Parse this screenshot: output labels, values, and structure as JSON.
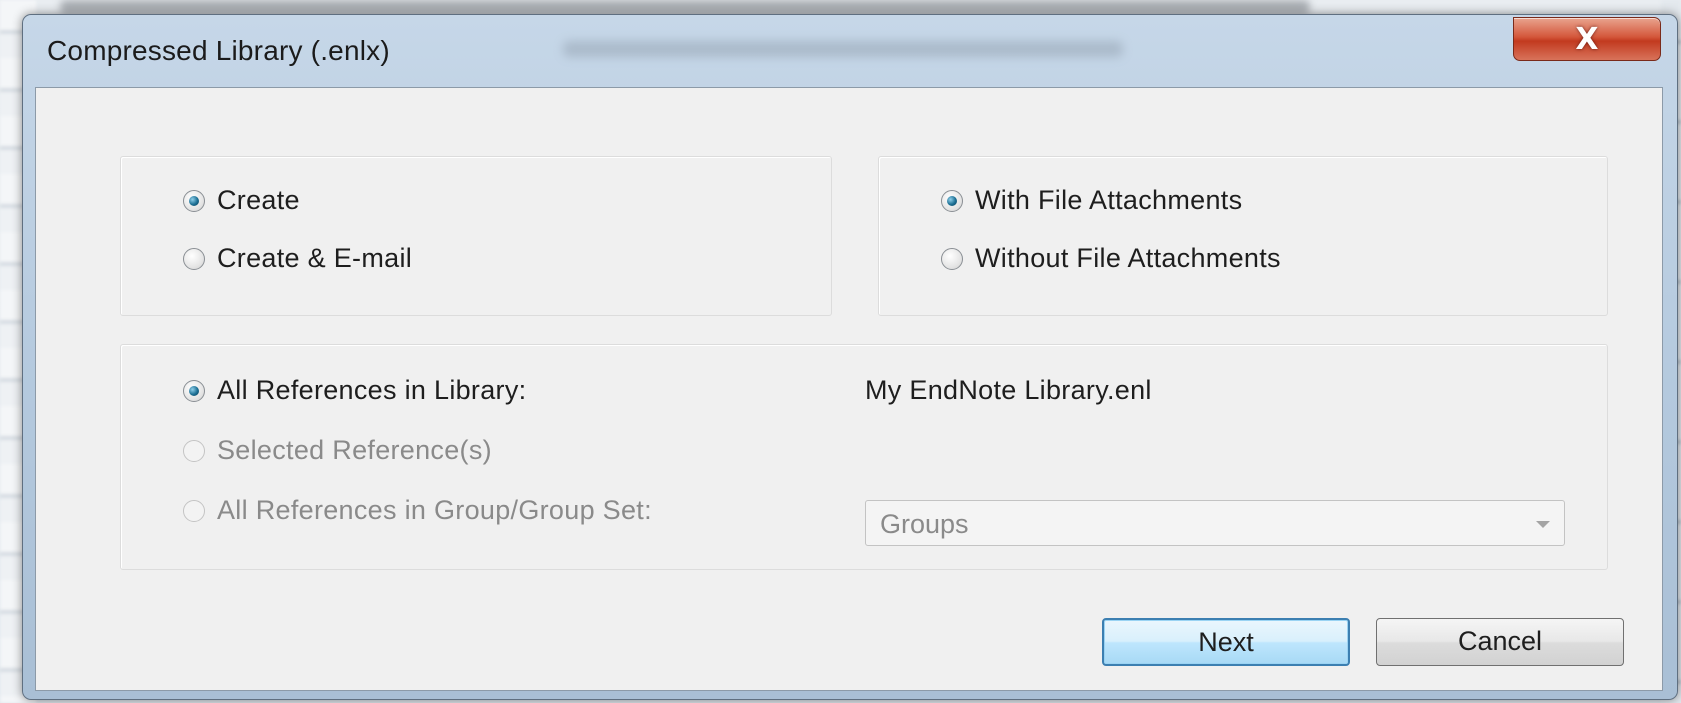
{
  "window": {
    "title": "Compressed Library (.enlx)",
    "close_glyph": "X"
  },
  "create_group": {
    "options": [
      {
        "label": "Create",
        "checked": true
      },
      {
        "label": "Create & E-mail",
        "checked": false
      }
    ]
  },
  "attachments_group": {
    "options": [
      {
        "label": "With File Attachments",
        "checked": true
      },
      {
        "label": "Without File Attachments",
        "checked": false
      }
    ]
  },
  "references_group": {
    "options": [
      {
        "label": "All References in Library:",
        "checked": true,
        "enabled": true
      },
      {
        "label": "Selected Reference(s)",
        "checked": false,
        "enabled": false
      },
      {
        "label": "All References in Group/Group Set:",
        "checked": false,
        "enabled": false
      }
    ],
    "library_name": "My EndNote Library.enl",
    "group_select": {
      "value": "Groups",
      "enabled": false
    }
  },
  "buttons": {
    "next": "Next",
    "cancel": "Cancel"
  },
  "colors": {
    "radio_checked": "#1b6e93",
    "default_button_border": "#3c7fb1",
    "close_button": "#c23a1f"
  }
}
